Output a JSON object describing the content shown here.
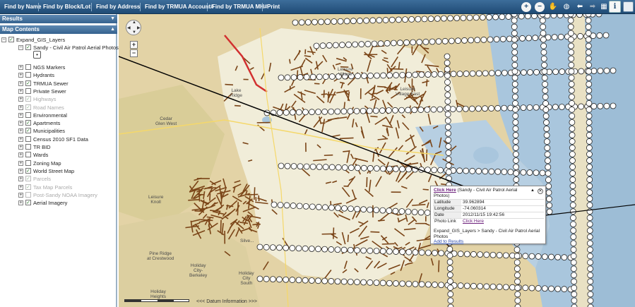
{
  "toolbar": {
    "items": [
      "Find by Name",
      "Find by Block/Lot",
      "Find by Address",
      "Find by TRMUA Account#",
      "Find by TRMUA MH#",
      "Print"
    ],
    "info_label": "i"
  },
  "results_panel": {
    "title": "Results"
  },
  "map_contents": {
    "title": "Map Contents",
    "root": "Expand_GIS_Layers",
    "sub_layer": "Sandy - Civil Air Patrol Aerial Photos",
    "layers": [
      {
        "label": "NGS Markers",
        "checked": false,
        "enabled": true
      },
      {
        "label": "Hydrants",
        "checked": false,
        "enabled": true
      },
      {
        "label": "TRMUA Sewer",
        "checked": true,
        "enabled": true
      },
      {
        "label": "Private Sewer",
        "checked": false,
        "enabled": true
      },
      {
        "label": "Highways",
        "checked": true,
        "enabled": false
      },
      {
        "label": "Road Names",
        "checked": true,
        "enabled": false
      },
      {
        "label": "Environmental",
        "checked": false,
        "enabled": true
      },
      {
        "label": "Apartments",
        "checked": true,
        "enabled": true
      },
      {
        "label": "Municipalities",
        "checked": true,
        "enabled": true
      },
      {
        "label": "Census 2010 SF1 Data",
        "checked": false,
        "enabled": true
      },
      {
        "label": "TR BID",
        "checked": false,
        "enabled": true
      },
      {
        "label": "Wards",
        "checked": false,
        "enabled": true
      },
      {
        "label": "Zoning Map",
        "checked": false,
        "enabled": true
      },
      {
        "label": "World Street Map",
        "checked": true,
        "enabled": true
      },
      {
        "label": "Parcels",
        "checked": true,
        "enabled": false
      },
      {
        "label": "Tax Map Parcels",
        "checked": true,
        "enabled": false
      },
      {
        "label": "Post-Sandy NOAA Imagery",
        "checked": false,
        "enabled": false
      },
      {
        "label": "Aerial Imagery",
        "checked": true,
        "enabled": true
      }
    ]
  },
  "map": {
    "places": {
      "cedar_glen_west": "Cedar\nGlen West",
      "lake_ridge": "Lake\nRidge",
      "leisure_knoll": "Leisure\nKnoll",
      "leisure_village": "Leisure\nVillage",
      "leisure_village_east": "Leisure\nVillage East",
      "pine_ridge": "Pine Ridge\nat Crestwood",
      "holiday_city_berkeley": "Holiday\nCity-\nBerkeley",
      "holiday_heights": "Holiday\nHeights",
      "holiday_city_south": "Holiday\nCity\nSouth",
      "silverton": "Silve..."
    },
    "datum_link": "<<< Datum Information >>>",
    "zoom_in": "+",
    "zoom_out": "−"
  },
  "popup": {
    "link": "Click Here",
    "title_rest": " (Sandy - Civil Air Patrol Aerial Photos)",
    "rows": [
      {
        "key": "Latitude",
        "value": "39.962894"
      },
      {
        "key": "Longitude",
        "value": "-74.060314"
      },
      {
        "key": "Date",
        "value": "2012/11/15 19:42:56"
      }
    ],
    "photo_link_key": "Photo Link",
    "photo_link_value": "Click Here",
    "breadcrumb": "Expand_GIS_Layers > Sandy - Civil Air Patrol Aerial Photos",
    "add_to_results": "Add to Results"
  },
  "colors": {
    "toolbar": "#2a5884",
    "water": "#a9c6dd",
    "land": "#e6d8b4",
    "urban": "#f2efe0",
    "parcel": "#7a4417"
  }
}
